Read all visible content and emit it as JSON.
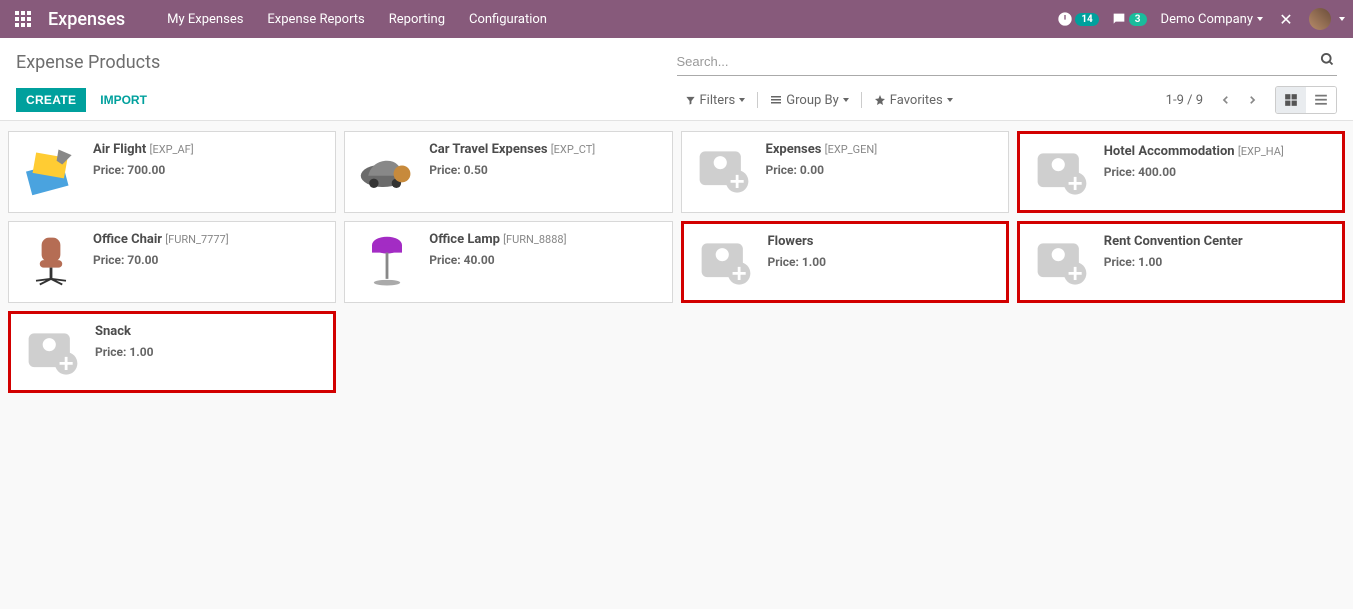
{
  "header": {
    "app_name": "Expenses",
    "menu": [
      "My Expenses",
      "Expense Reports",
      "Reporting",
      "Configuration"
    ],
    "clock_badge": "14",
    "chat_badge": "3",
    "company": "Demo Company"
  },
  "breadcrumb": "Expense Products",
  "search": {
    "placeholder": "Search..."
  },
  "toolbar": {
    "create": "CREATE",
    "import": "IMPORT",
    "filters": "Filters",
    "group_by": "Group By",
    "favorites": "Favorites"
  },
  "pager": {
    "text": "1-9 / 9"
  },
  "products": [
    {
      "name": "Air Flight",
      "code": "[EXP_AF]",
      "price_label": "Price:",
      "price": "700.00",
      "highlighted": false,
      "image": "airflight"
    },
    {
      "name": "Car Travel Expenses",
      "code": "[EXP_CT]",
      "price_label": "Price:",
      "price": "0.50",
      "highlighted": false,
      "image": "car"
    },
    {
      "name": "Expenses",
      "code": "[EXP_GEN]",
      "price_label": "Price:",
      "price": "0.00",
      "highlighted": false,
      "image": "placeholder"
    },
    {
      "name": "Hotel Accommodation",
      "code": "[EXP_HA]",
      "price_label": "Price:",
      "price": "400.00",
      "highlighted": true,
      "image": "placeholder"
    },
    {
      "name": "Office Chair",
      "code": "[FURN_7777]",
      "price_label": "Price:",
      "price": "70.00",
      "highlighted": false,
      "image": "chair"
    },
    {
      "name": "Office Lamp",
      "code": "[FURN_8888]",
      "price_label": "Price:",
      "price": "40.00",
      "highlighted": false,
      "image": "lamp"
    },
    {
      "name": "Flowers",
      "code": "",
      "price_label": "Price:",
      "price": "1.00",
      "highlighted": true,
      "image": "placeholder"
    },
    {
      "name": "Rent Convention Center",
      "code": "",
      "price_label": "Price:",
      "price": "1.00",
      "highlighted": true,
      "image": "placeholder"
    },
    {
      "name": "Snack",
      "code": "",
      "price_label": "Price:",
      "price": "1.00",
      "highlighted": true,
      "image": "placeholder"
    }
  ]
}
